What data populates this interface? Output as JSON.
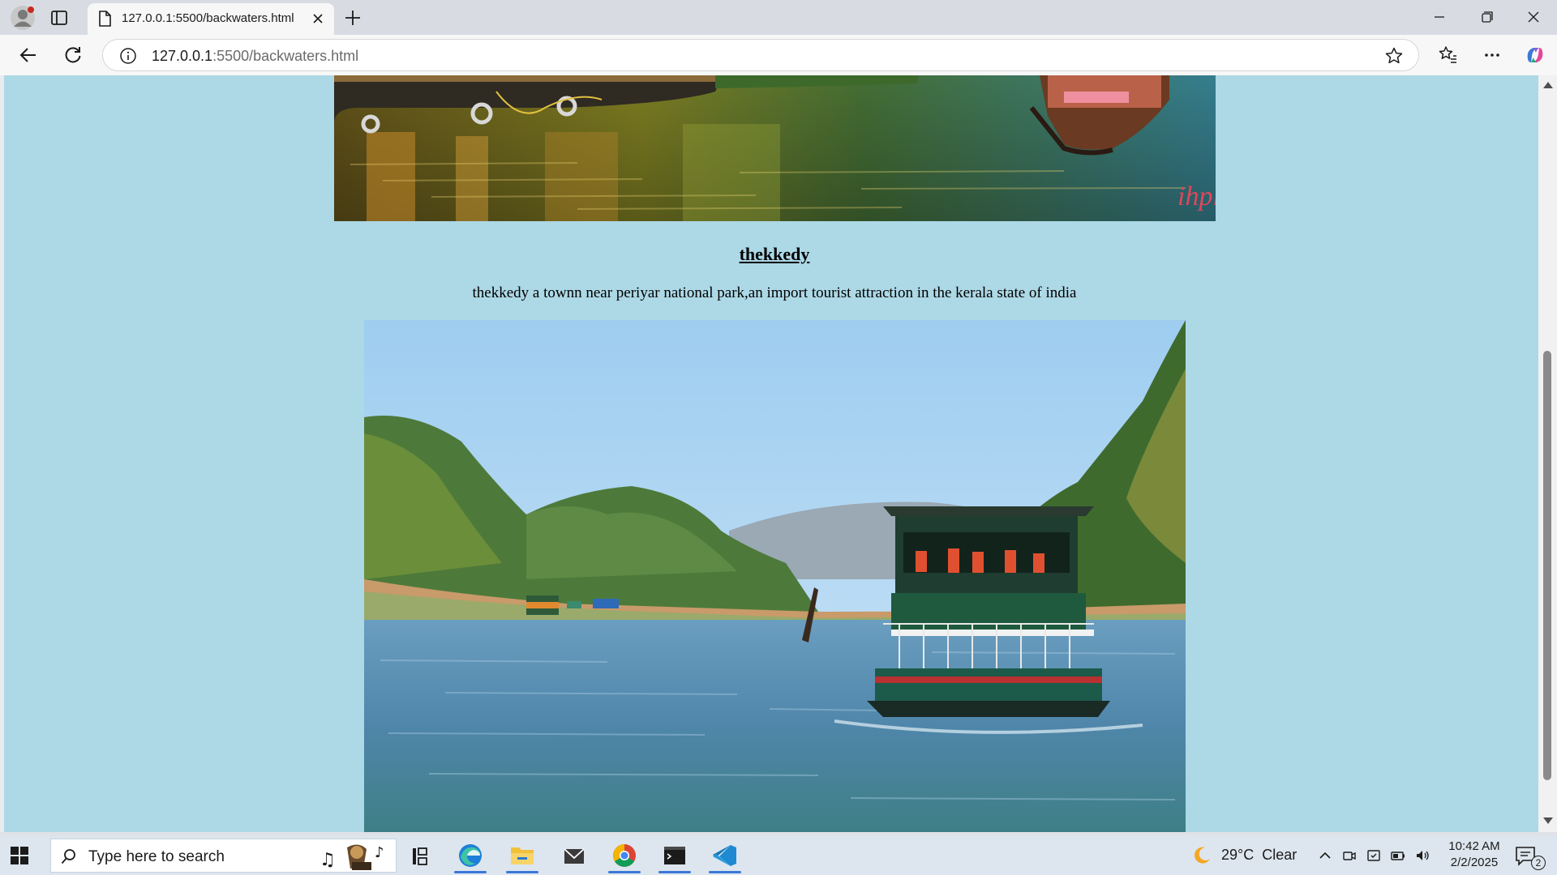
{
  "browser": {
    "tab_title": "127.0.0.1:5500/backwaters.html",
    "url_host": "127.0.0.1",
    "url_path": ":5500/backwaters.html"
  },
  "page": {
    "heading": "thekkedy",
    "description": "thekkedy a townn near periyar national park,an import tourist attraction in the kerala state of india",
    "top_image_watermark": "ihpl"
  },
  "colors": {
    "page_background": "#add8e6",
    "accent": "#3b78d8"
  },
  "taskbar": {
    "search_placeholder": "Type here to search",
    "apps": [
      "task-view-icon",
      "edge-icon",
      "file-explorer-icon",
      "mail-icon",
      "chrome-icon",
      "terminal-icon",
      "vscode-icon"
    ],
    "weather_temp": "29°C",
    "weather_condition": "Clear",
    "time": "10:42 AM",
    "date": "2/2/2025",
    "notification_count": "2"
  }
}
